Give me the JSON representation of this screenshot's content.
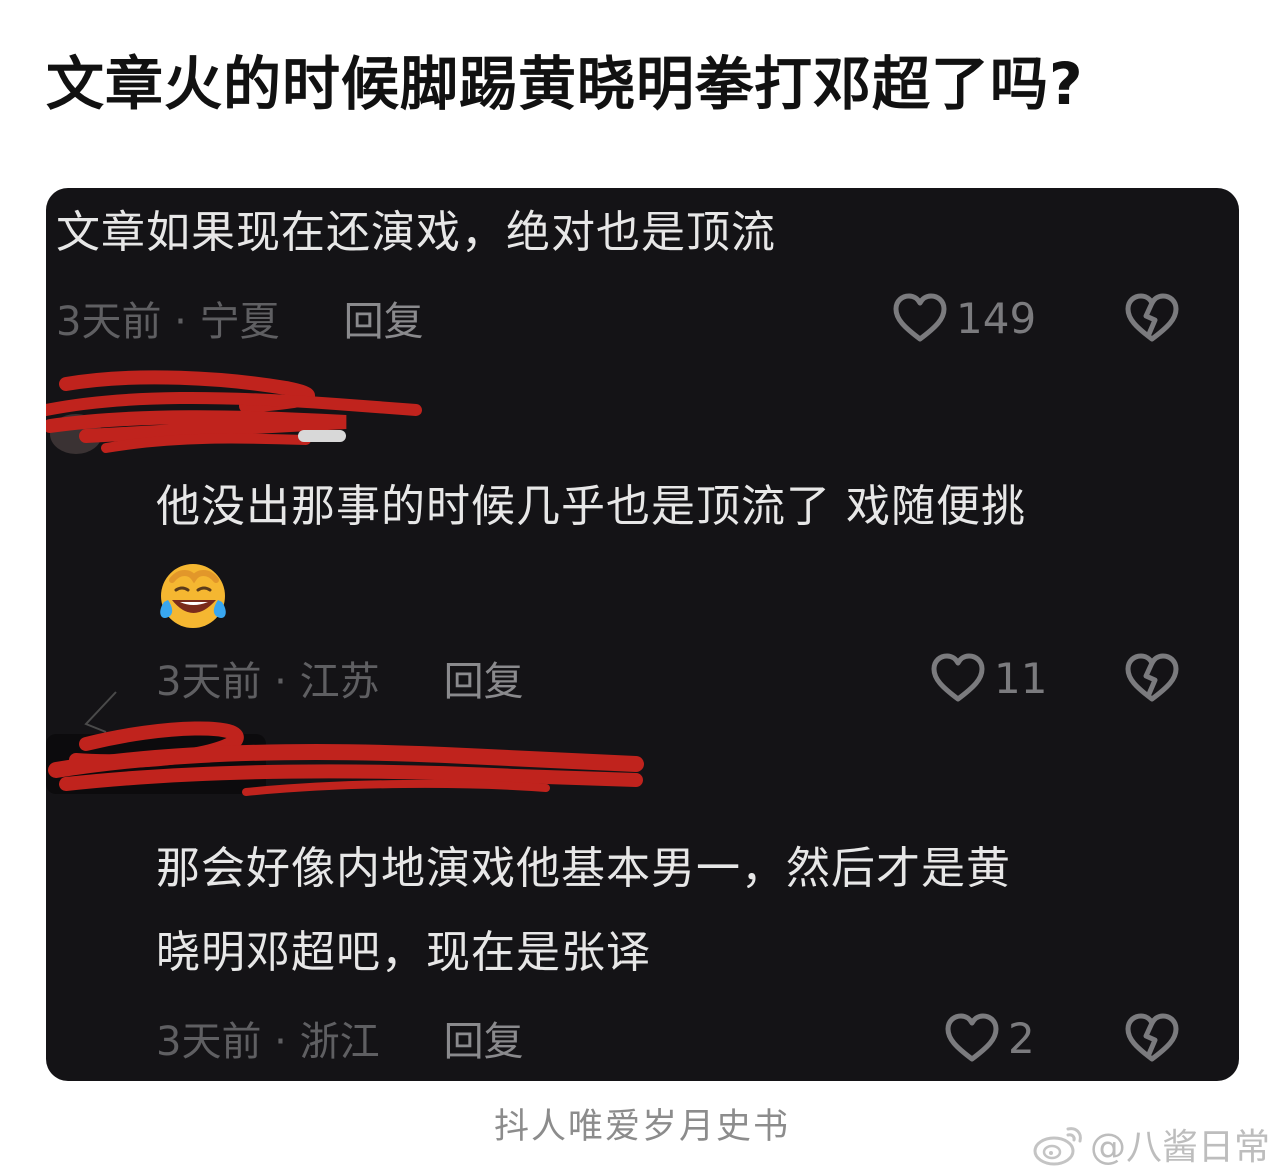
{
  "headline": "文章火的时候脚踢黄晓明拳打邓超了吗?",
  "comments": [
    {
      "text": "文章如果现在还演戏，绝对也是顶流",
      "meta": "3天前 · 宁夏",
      "reply_label": "回复",
      "likes": "149",
      "like_icon": "heart-outline-icon",
      "dislike_icon": "broken-heart-icon"
    },
    {
      "text": "他没出那事的时候几乎也是顶流了 戏随便挑",
      "emoji": "laughing-crying-face-emoji",
      "meta": "3天前 · 江苏",
      "reply_label": "回复",
      "likes": "11",
      "like_icon": "heart-outline-icon",
      "dislike_icon": "broken-heart-icon"
    },
    {
      "text_line1": "那会好像内地演戏他基本男一，然后才是黄",
      "text_line2": "晓明邓超吧，现在是张译",
      "meta": "3天前 · 浙江",
      "reply_label": "回复",
      "likes": "2",
      "like_icon": "heart-outline-icon",
      "dislike_icon": "broken-heart-icon"
    }
  ],
  "footer": {
    "source": "抖人唯爱岁月史书",
    "watermark": "@八酱日常",
    "watermark_icon": "weibo-icon"
  },
  "colors": {
    "card_background": "#141316",
    "comment_text": "#e7e7e7",
    "meta_text": "#6f6f72",
    "redaction": "#c0231d"
  }
}
